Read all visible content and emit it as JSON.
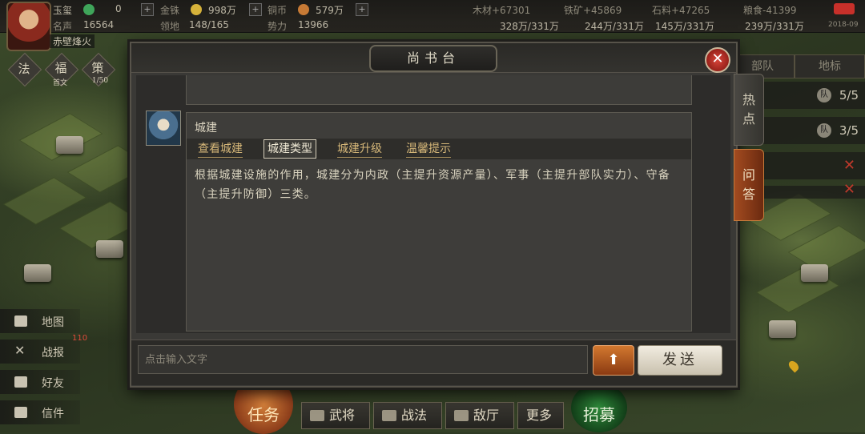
{
  "topbar": {
    "player_name": "玉玺",
    "coins": "0",
    "gold_label": "金铢",
    "gold_value": "998万",
    "copper_label": "铜币",
    "copper_value": "579万",
    "fame_label": "名声",
    "fame_value": "16564",
    "land_label": "领地",
    "land_value": "148/165",
    "power_label": "势力",
    "power_value": "13966",
    "season": "赤壁烽火",
    "wood": "木材+67301",
    "iron": "铁矿+45869",
    "stone": "石料+47265",
    "grain": "粮食-41399",
    "wood_store": "328万/331万",
    "iron_store": "244万/331万",
    "stone_store": "145万/331万",
    "grain_store": "239万/331万",
    "time": "2018-09"
  },
  "policies": [
    {
      "label": "法"
    },
    {
      "label": "福",
      "sub": "首文"
    },
    {
      "label": "策",
      "sub": "1/50"
    }
  ],
  "left_menu": {
    "map": "地图",
    "report": "战报",
    "report_badge": "110",
    "friends": "好友",
    "mail": "信件"
  },
  "right_hud": {
    "tab_troops": "部队",
    "tab_landmark": "地标",
    "row1_value": "5/5",
    "row2_value": "3/5",
    "badge": "队"
  },
  "bottom": {
    "task": "任务",
    "generals": "武将",
    "tactics": "战法",
    "hall": "敌厅",
    "more": "更多",
    "recruit": "招募"
  },
  "dialog": {
    "title": "尚书台",
    "close": "✕",
    "side_tab_hot": "热点",
    "side_tab_qa": "问答",
    "reply_title": "城建",
    "tabs": [
      "查看城建",
      "城建类型",
      "城建升级",
      "温馨提示"
    ],
    "active_tab_index": 1,
    "answer": "根据城建设施的作用，城建分为内政（主提升资源产量）、军事（主提升部队实力）、守备（主提升防御）三类。",
    "input_placeholder": "点击输入文字",
    "up_arrow": "⬆",
    "send": "发送"
  }
}
